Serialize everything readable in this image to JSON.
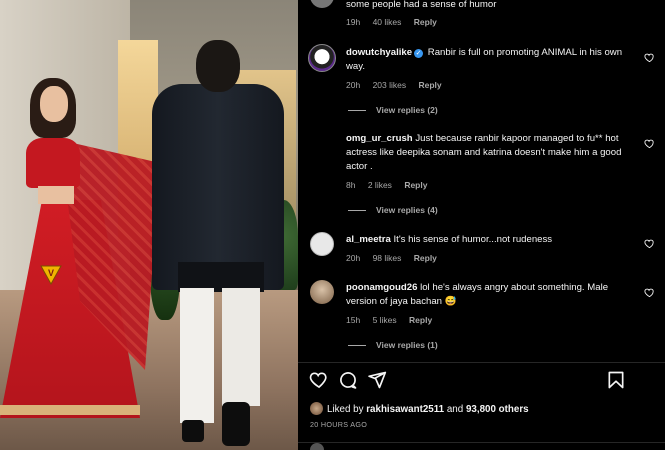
{
  "post": {
    "logo_letter": "V"
  },
  "comments": [
    {
      "username": "",
      "text": "some people had a sense of humor",
      "time": "19h",
      "likes": "40 likes",
      "reply": "Reply"
    },
    {
      "username": "dowutchyalike",
      "verified": true,
      "text": "Ranbir is full on promoting ANIMAL in his own way.",
      "time": "20h",
      "likes": "203 likes",
      "reply": "Reply",
      "view_replies": "View replies (2)"
    },
    {
      "username": "omg_ur_crush",
      "text": "Just because ranbir kapoor managed to fu** hot actress like deepika sonam and katrina doesn't make him a good actor .",
      "time": "8h",
      "likes": "2 likes",
      "reply": "Reply",
      "view_replies": "View replies (4)"
    },
    {
      "username": "al_meetra",
      "text": "It's his sense of humor...not rudeness",
      "time": "20h",
      "likes": "98 likes",
      "reply": "Reply"
    },
    {
      "username": "poonamgoud26",
      "text": "lol he's always angry about something. Male version of jaya bachan 😅",
      "time": "15h",
      "likes": "5 likes",
      "reply": "Reply",
      "view_replies": "View replies (1)"
    }
  ],
  "footer": {
    "liked_by_prefix": "Liked by",
    "liked_by_user": "rakhisawant2511",
    "and_word": "and",
    "others": "93,800 others",
    "time_ago": "20 HOURS AGO"
  },
  "colors": {
    "background": "#000000",
    "text": "#f5f5f5",
    "muted": "#a8a8a8",
    "verified": "#3897f0"
  },
  "icons": [
    "heart-icon",
    "comment-icon",
    "share-icon",
    "bookmark-icon",
    "verified-icon"
  ]
}
